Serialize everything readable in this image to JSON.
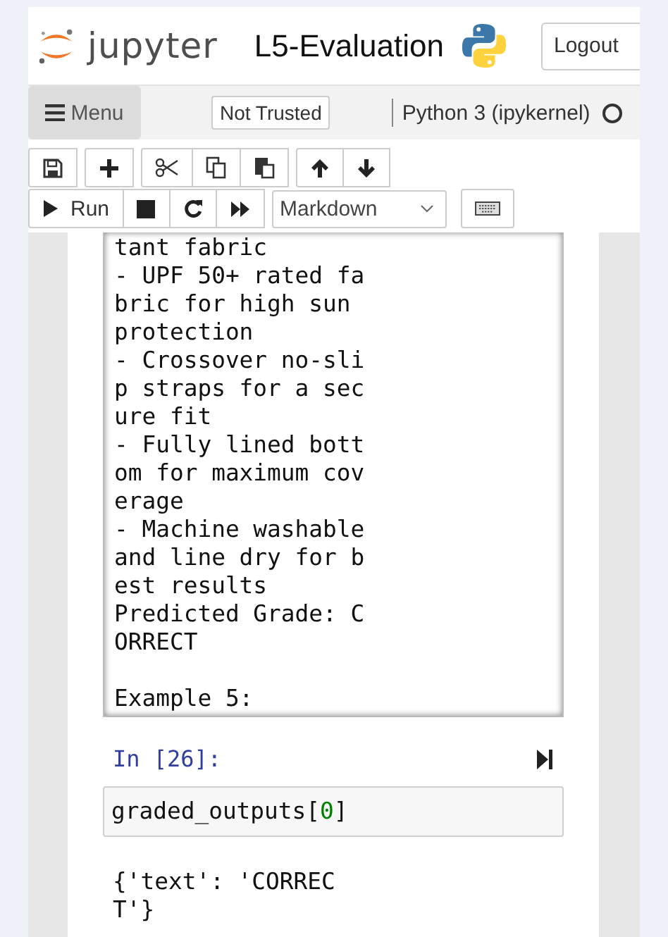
{
  "header": {
    "brand": "jupyter",
    "notebook_name": "L5-Evaluation",
    "logout": "Logout"
  },
  "menubar": {
    "menu": "Menu",
    "trust": "Not Trusted",
    "kernel": "Python 3 (ipykernel)",
    "kernel_busy": false
  },
  "toolbar": {
    "groups": [
      [
        {
          "kind": "save"
        }
      ],
      [
        {
          "kind": "add"
        }
      ],
      [
        {
          "kind": "cut"
        },
        {
          "kind": "copy"
        },
        {
          "kind": "paste"
        }
      ],
      [
        {
          "kind": "up"
        },
        {
          "kind": "down"
        }
      ]
    ],
    "run_group": [
      {
        "kind": "run",
        "label": "Run"
      },
      {
        "kind": "stop"
      },
      {
        "kind": "restart"
      },
      {
        "kind": "fast-forward"
      }
    ],
    "cell_type": "Markdown"
  },
  "cells": [
    {
      "kind": "output",
      "blocks": [
        [
          "tant fabric",
          "- UPF 50+ rated fa",
          "bric for high sun",
          "protection",
          "- Crossover no-sli",
          "p straps for a sec",
          "ure fit",
          "- Fully lined bott",
          "om for maximum cov",
          "erage",
          "- Machine washable",
          "and line dry for b",
          "est results",
          "Predicted Grade: C",
          "ORRECT"
        ],
        [
          "Example 5:"
        ]
      ]
    },
    {
      "kind": "code",
      "prompt": "In [26]:",
      "tokens": [
        {
          "kind": "name",
          "text": "graded_outputs["
        },
        {
          "kind": "number",
          "text": "0"
        },
        {
          "kind": "name",
          "text": "]"
        }
      ],
      "result": [
        "{'text': 'CORREC",
        "T'}"
      ]
    }
  ]
}
